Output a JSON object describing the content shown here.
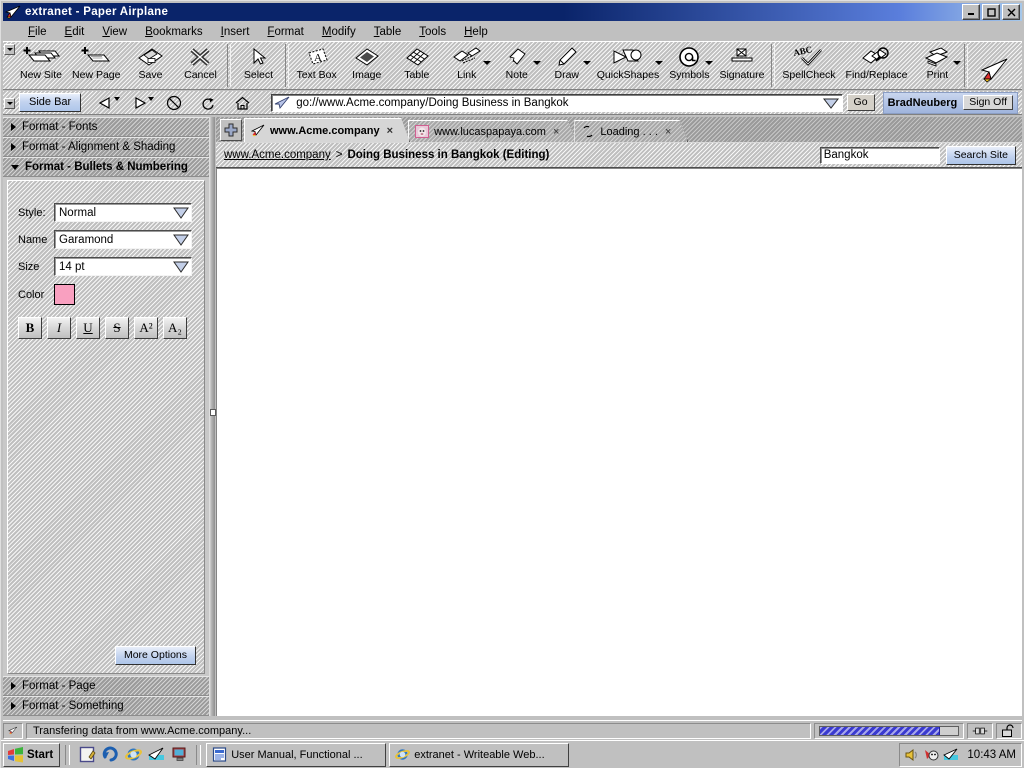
{
  "window": {
    "title": "extranet - Paper Airplane",
    "icon": "paper-airplane-icon",
    "minimize_label": "_",
    "maximize_label": "□",
    "close_label": "✕"
  },
  "menubar": {
    "items": [
      {
        "label": "File",
        "accel": "F"
      },
      {
        "label": "Edit",
        "accel": "E"
      },
      {
        "label": "View",
        "accel": "V"
      },
      {
        "label": "Bookmarks",
        "accel": "B"
      },
      {
        "label": "Insert",
        "accel": "I"
      },
      {
        "label": "Format",
        "accel": "F"
      },
      {
        "label": "Modify",
        "accel": "M"
      },
      {
        "label": "Table",
        "accel": "T"
      },
      {
        "label": "Tools",
        "accel": "T"
      },
      {
        "label": "Help",
        "accel": "H"
      }
    ]
  },
  "toolbar": {
    "groups": [
      {
        "buttons": [
          {
            "label": "New Site",
            "icon": "new-site-icon",
            "caret": false
          },
          {
            "label": "New Page",
            "icon": "new-page-icon",
            "caret": false
          },
          {
            "label": "Save",
            "icon": "save-icon",
            "caret": false
          },
          {
            "label": "Cancel",
            "icon": "cancel-icon",
            "caret": false
          }
        ]
      },
      {
        "buttons": [
          {
            "label": "Select",
            "icon": "select-cursor-icon",
            "caret": false
          }
        ]
      },
      {
        "buttons": [
          {
            "label": "Text Box",
            "icon": "text-box-icon",
            "caret": false
          },
          {
            "label": "Image",
            "icon": "image-icon",
            "caret": false
          },
          {
            "label": "Table",
            "icon": "table-icon",
            "caret": false
          },
          {
            "label": "Link",
            "icon": "link-icon",
            "caret": true
          },
          {
            "label": "Note",
            "icon": "note-icon",
            "caret": true
          },
          {
            "label": "Draw",
            "icon": "draw-pencil-icon",
            "caret": true
          },
          {
            "label": "QuickShapes",
            "icon": "quickshapes-icon",
            "caret": true
          },
          {
            "label": "Symbols",
            "icon": "symbols-at-icon",
            "caret": true
          },
          {
            "label": "Signature",
            "icon": "signature-icon",
            "caret": false
          }
        ]
      },
      {
        "buttons": [
          {
            "label": "SpellCheck",
            "icon": "spellcheck-icon",
            "caret": false
          },
          {
            "label": "Find/Replace",
            "icon": "find-replace-icon",
            "caret": false
          },
          {
            "label": "Print",
            "icon": "print-icon",
            "caret": true
          }
        ]
      }
    ],
    "brand_icon": "paper-airplane-icon"
  },
  "navbar": {
    "sidebar_button": "Side Bar",
    "back": "back-arrow-icon",
    "forward": "forward-arrow-icon",
    "stop": "stop-icon",
    "reload": "reload-icon",
    "home": "home-icon",
    "address_icon": "paper-airplane-small-icon",
    "address_value": "go://www.Acme.company/Doing Business in Bangkok",
    "address_placeholder": "go://",
    "go_label": "Go",
    "user_name": "BradNeuberg",
    "sign_off_label": "Sign Off"
  },
  "sidebar": {
    "sections": [
      {
        "label": "Format - Fonts",
        "expanded": false
      },
      {
        "label": "Format - Alignment & Shading",
        "expanded": false
      },
      {
        "label": "Format - Bullets & Numbering",
        "expanded": true
      }
    ],
    "bottom_sections": [
      {
        "label": "Format - Page",
        "expanded": false
      },
      {
        "label": "Format - Something",
        "expanded": false
      }
    ],
    "fields": [
      {
        "label": "Style:",
        "value": "Normal",
        "name": "style-select"
      },
      {
        "label": "Name",
        "value": "Garamond",
        "name": "font-name-select"
      },
      {
        "label": "Size",
        "value": "14 pt",
        "name": "font-size-select"
      }
    ],
    "color_label": "Color",
    "color_value": "#f9a0c0",
    "format_buttons": [
      {
        "label": "B",
        "name": "bold-button",
        "style": "bold"
      },
      {
        "label": "I",
        "name": "italic-button",
        "style": "italic"
      },
      {
        "label": "U",
        "name": "underline-button",
        "style": "underline"
      },
      {
        "label": "S",
        "name": "strikethrough-button",
        "style": "strike"
      },
      {
        "label": "A²",
        "name": "superscript-button",
        "style": "normal"
      },
      {
        "label": "A₂",
        "name": "subscript-button",
        "style": "normal"
      }
    ],
    "more_options": "More Options"
  },
  "tabs": {
    "new_tab_icon": "plus-icon",
    "items": [
      {
        "label": "www.Acme.company",
        "selected": true,
        "favicon": "paper-airplane-icon",
        "close": "×"
      },
      {
        "label": "www.lucaspapaya.com",
        "selected": false,
        "favicon": "papaya-photo-icon",
        "close": "×"
      },
      {
        "label": "Loading . . .",
        "selected": false,
        "favicon": "loading-spinner-icon",
        "close": "×"
      }
    ]
  },
  "breadcrumb": {
    "root": "www.Acme.company",
    "separator": ">",
    "current": "Doing Business in Bangkok (Editing)"
  },
  "search": {
    "value": "Bangkok",
    "placeholder": "",
    "button_label": "Search Site"
  },
  "statusbar": {
    "icon": "paper-airplane-icon",
    "message": "Transfering data from www.Acme.company...",
    "progress_percent": 86,
    "connection_icon": "network-connection-icon",
    "security_icon": "open-lock-icon"
  },
  "taskbar": {
    "start_label": "Start",
    "quick_launch": [
      {
        "name": "notepad-icon"
      },
      {
        "name": "undo-icon"
      },
      {
        "name": "internet-explorer-icon"
      },
      {
        "name": "paper-airplane-icon"
      },
      {
        "name": "show-desktop-icon"
      }
    ],
    "tasks": [
      {
        "label": "User Manual, Functional ...",
        "icon": "document-icon"
      },
      {
        "label": "extranet - Writeable Web...",
        "icon": "internet-explorer-icon"
      }
    ],
    "tray_icons": [
      {
        "name": "volume-icon"
      },
      {
        "name": "antivirus-icon"
      },
      {
        "name": "paper-airplane-icon"
      }
    ],
    "clock": "10:43 AM"
  },
  "colors": {
    "titlebar_start": "#0a246a",
    "titlebar_end": "#a6c8ea",
    "face": "#c0c0c0",
    "accent_blue": "#aec6ea",
    "progress": "#3a3ad0",
    "swatch_pink": "#f9a0c0"
  }
}
